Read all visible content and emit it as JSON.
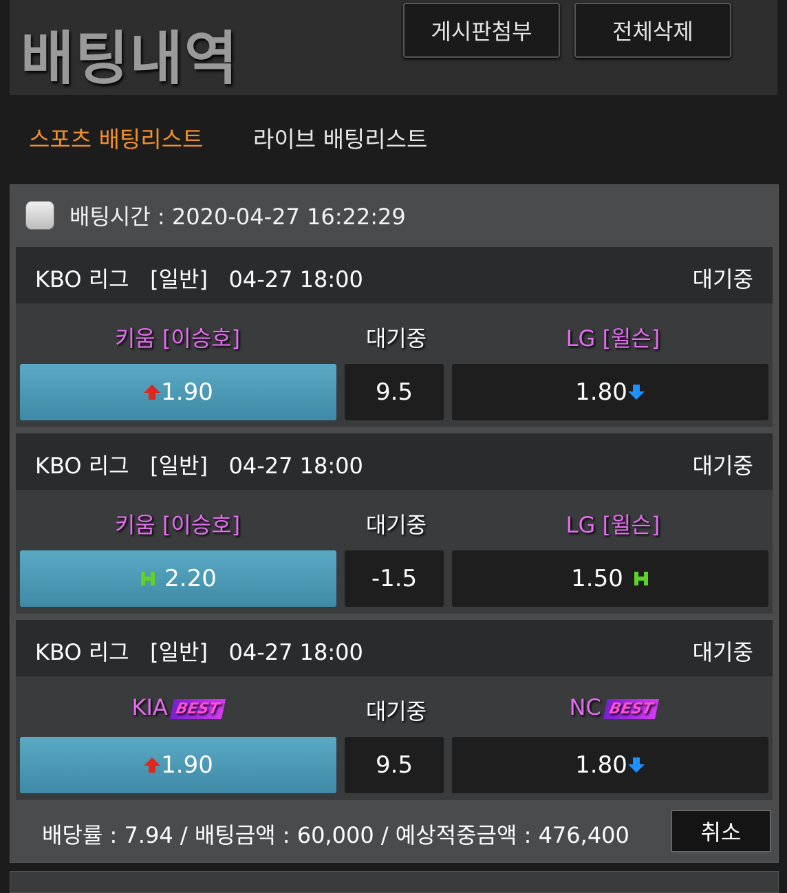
{
  "header": {
    "title": "배팅내역",
    "attach_board_label": "게시판첨부",
    "delete_all_label": "전체삭제"
  },
  "tabs": [
    {
      "label": "스포츠 배팅리스트",
      "active": true,
      "color": "#f2902a"
    },
    {
      "label": "라이브 배팅리스트",
      "active": false,
      "color": "#e8e8e8"
    }
  ],
  "slip": {
    "bet_time": "배팅시간 : 2020-04-27 16:22:29",
    "bets": [
      {
        "league": "KBO 리그   [일반]   04-27 18:00",
        "status": "대기중",
        "home_team": "키움 [이승호]",
        "home_best": "",
        "mid_label": "대기중",
        "away_team": "LG [윌슨]",
        "away_best": "",
        "home_odd": "1.90",
        "home_icon": "arrow-up-icon",
        "mid_value": "9.5",
        "away_odd": "1.80",
        "away_icon": "arrow-down-icon"
      },
      {
        "league": "KBO 리그   [일반]   04-27 18:00",
        "status": "대기중",
        "home_team": "키움 [이승호]",
        "home_best": "",
        "mid_label": "대기중",
        "away_team": "LG [윌슨]",
        "away_best": "",
        "home_odd": "2.20",
        "home_icon": "handicap-h-icon",
        "mid_value": "-1.5",
        "away_odd": "1.50",
        "away_icon": "handicap-h-icon"
      },
      {
        "league": "KBO 리그   [일반]   04-27 18:00",
        "status": "대기중",
        "home_team": "KIA",
        "home_best": "BEST",
        "mid_label": "대기중",
        "away_team": "NC",
        "away_best": "BEST",
        "home_odd": "1.90",
        "home_icon": "arrow-up-icon",
        "mid_value": "9.5",
        "away_odd": "1.80",
        "away_icon": "arrow-down-icon"
      }
    ],
    "summary": "배당률 : 7.94 / 배팅금액 : 60,000 / 예상적중금액 : 476,400",
    "cancel_label": "취소"
  },
  "colors": {
    "accent_tab": "#f2902a",
    "team_name": "#e46cf0",
    "home_odd_bg": "#4a9bb8",
    "arrow_up": "#e0261f",
    "arrow_down": "#1e90ff",
    "handicap_h": "#5fd12a"
  }
}
